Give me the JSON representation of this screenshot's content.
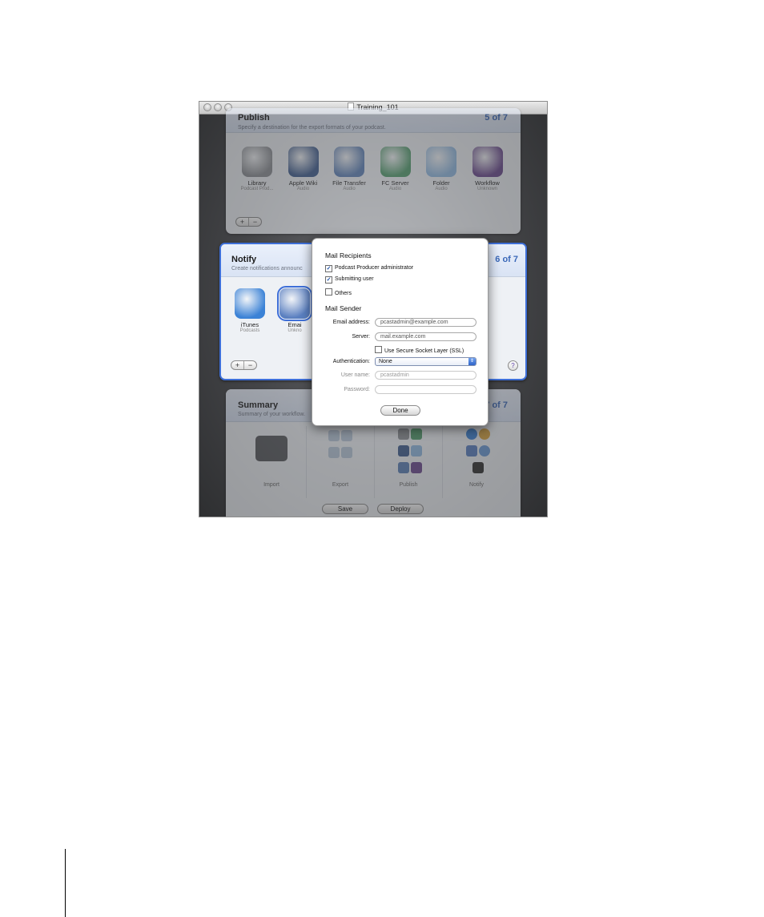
{
  "window": {
    "title": "Training_101"
  },
  "publish": {
    "title": "Publish",
    "subtitle": "Specify a destination for the export formats of your podcast.",
    "step": "5 of 7",
    "services": [
      {
        "name": "Library",
        "sub": "Podcast Prod...",
        "icon": "library-icon",
        "color": "#8c8f94"
      },
      {
        "name": "Apple Wiki",
        "sub": "Audio",
        "icon": "wiki-icon",
        "color": "#3d5b8d"
      },
      {
        "name": "File Transfer",
        "sub": "Audio",
        "icon": "file-transfer-icon",
        "color": "#5b7fb5"
      },
      {
        "name": "FC Server",
        "sub": "Audio",
        "icon": "fc-server-icon",
        "color": "#4f9a6a"
      },
      {
        "name": "Folder",
        "sub": "Audio",
        "icon": "folder-icon",
        "color": "#8eb7df"
      },
      {
        "name": "Workflow",
        "sub": "Unknown",
        "icon": "workflow-icon",
        "color": "#6b4a8e"
      }
    ],
    "add": "+",
    "remove": "−"
  },
  "notify": {
    "title": "Notify",
    "subtitle": "Create notifications announc",
    "step": "6 of 7",
    "services": [
      {
        "name": "iTunes",
        "sub": "Podcasts",
        "icon": "itunes-icon",
        "color": "#3b82d6"
      },
      {
        "name": "Emai",
        "sub": "Unkno",
        "icon": "email-icon",
        "color": "#5a7fc0"
      }
    ],
    "add": "+",
    "remove": "−",
    "help": "?"
  },
  "summary": {
    "title": "Summary",
    "subtitle": "Summary of your workflow.",
    "step": "7 of 7",
    "columns": [
      "Import",
      "Export",
      "Publish",
      "Notify"
    ],
    "save": "Save",
    "deploy": "Deploy"
  },
  "dialog": {
    "recipients_heading": "Mail Recipients",
    "recipients": [
      {
        "label": "Podcast Producer administrator",
        "checked": true
      },
      {
        "label": "Submitting user",
        "checked": true
      },
      {
        "label": "Others",
        "checked": false
      }
    ],
    "sender_heading": "Mail Sender",
    "email_label": "Email address:",
    "email_value": "pcastadmin@example.com",
    "server_label": "Server:",
    "server_value": "mail.example.com",
    "ssl_label": "Use Secure Socket Layer (SSL)",
    "ssl_checked": false,
    "auth_label": "Authentication:",
    "auth_value": "None",
    "user_label": "User name:",
    "user_value": "pcastadmin",
    "password_label": "Password:",
    "password_value": "",
    "done": "Done"
  },
  "colors": {
    "accent": "#3a68b8",
    "selected_border": "#3e6fd8"
  }
}
